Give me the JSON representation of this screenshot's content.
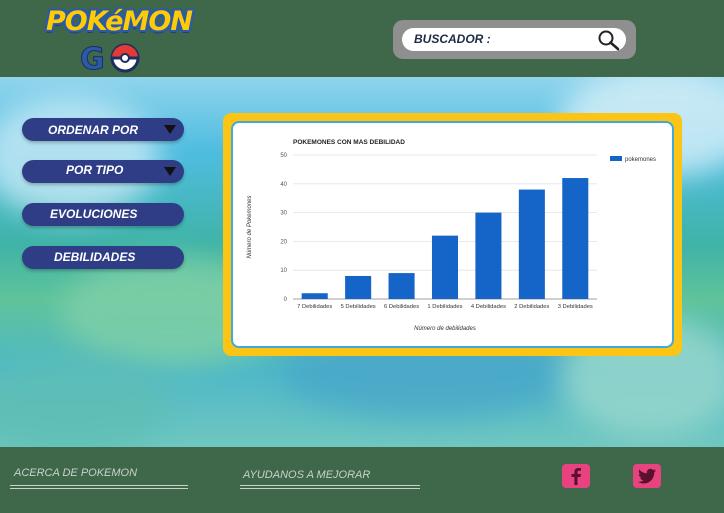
{
  "header": {
    "logo_text": "POKéMON",
    "logo_go": "GO",
    "search_label": "BUSCADOR :",
    "search_value": ""
  },
  "menu": {
    "items": [
      {
        "label": "ORDENAR POR",
        "dropdown": true
      },
      {
        "label": "POR TIPO",
        "dropdown": true
      },
      {
        "label": "EVOLUCIONES",
        "dropdown": false
      },
      {
        "label": "DEBILIDADES",
        "dropdown": false
      }
    ]
  },
  "footer": {
    "about": "ACERCA DE POKEMON",
    "help": "AYUDANOS A MEJORAR",
    "facebook_icon": "facebook-icon",
    "twitter_icon": "twitter-icon"
  },
  "colors": {
    "header_bg": "#3f674a",
    "menu_btn": "#2e3d86",
    "chart_frame": "#fcc414",
    "bar": "#1565c8",
    "social": "#e9437f"
  },
  "chart_data": {
    "type": "bar",
    "title": "POKEMONES CON MAS DEBILIDAD",
    "xlabel": "Número de debilidades",
    "ylabel": "Número de Pokemones",
    "categories": [
      "7 Debilidades",
      "5 Debilidades",
      "6 Debilidades",
      "1 Debilidades",
      "4 Debilidades",
      "2 Debilidades",
      "3 Debilidades"
    ],
    "series": [
      {
        "name": "pokemones",
        "values": [
          2,
          8,
          9,
          22,
          30,
          38,
          42
        ]
      }
    ],
    "yticks": [
      0,
      10,
      20,
      30,
      40,
      50
    ],
    "ylim": [
      0,
      50
    ],
    "grid": true,
    "legend": "top-right"
  }
}
